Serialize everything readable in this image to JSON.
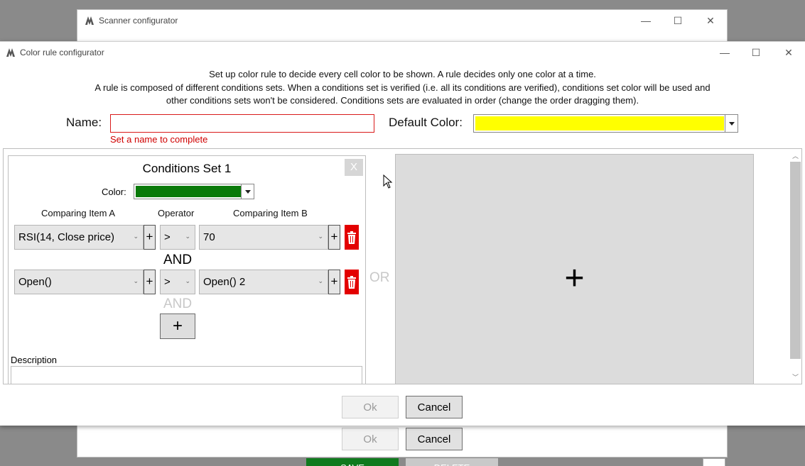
{
  "back_window": {
    "title": "Scanner configurator",
    "minimize": "—",
    "maximize": "☐",
    "close": "✕",
    "ok_label": "Ok",
    "cancel_label": "Cancel",
    "save_label": "SAVE",
    "delete_label": "DELETE"
  },
  "window": {
    "title": "Color rule configurator",
    "minimize": "—",
    "maximize": "☐",
    "close": "✕"
  },
  "instructions": {
    "line1": "Set up color rule to decide every cell color to be shown. A rule decides only one color at a time.",
    "line2": "A rule is composed of different conditions sets. When a conditions set is verified (i.e. all its conditions are verified), conditions set color will be used and",
    "line3": "other conditions sets won't be considered. Conditions sets are evaluated in order (change the order dragging them)."
  },
  "form": {
    "name_label": "Name:",
    "name_value": "",
    "name_error": "Set a name to complete",
    "default_color_label": "Default Color:",
    "default_color": "#ffff00"
  },
  "conditions_set": {
    "title": "Conditions Set 1",
    "close_label": "X",
    "color_label": "Color:",
    "color": "#0a7a0a",
    "header_a": "Comparing Item A",
    "header_op": "Operator",
    "header_b": "Comparing Item B",
    "rows": [
      {
        "item_a": "RSI(14, Close price)",
        "operator": ">",
        "item_b": "70"
      },
      {
        "item_a": "Open()",
        "operator": ">",
        "item_b": "Open() 2"
      }
    ],
    "and_label": "AND",
    "and_label_next": "AND",
    "add_condition_label": "+",
    "description_label": "Description",
    "description_value": ""
  },
  "or_label": "OR",
  "add_set_label": "+",
  "buttons": {
    "ok_label": "Ok",
    "cancel_label": "Cancel"
  },
  "icons": {
    "trash": "trash-icon",
    "plus": "plus-icon",
    "chevron": "chevron-down-icon"
  }
}
